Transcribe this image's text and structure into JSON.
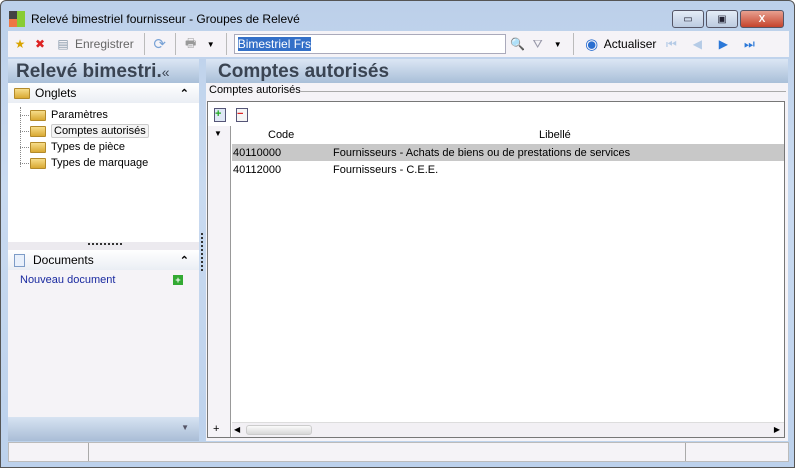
{
  "window": {
    "title": "Relevé bimestriel fournisseur -  Groupes de Relevé",
    "minimize": "▭",
    "maximize": "▣",
    "close": "X"
  },
  "toolbar": {
    "save_label": "Enregistrer",
    "search_value": "Bimestriel Frs",
    "refresh_label": "Actualiser"
  },
  "left_panel": {
    "title": "Relevé bimestri.",
    "collapse": "«",
    "onglets_header": "Onglets",
    "onglets_items": [
      {
        "label": "Paramètres"
      },
      {
        "label": "Comptes autorisés"
      },
      {
        "label": "Types de pièce"
      },
      {
        "label": "Types de marquage"
      }
    ],
    "documents_header": "Documents",
    "new_document_link": "Nouveau document",
    "chevron": "⌃"
  },
  "main": {
    "title": "Comptes autorisés",
    "group_label": "Comptes autorisés",
    "columns": {
      "code": "Code",
      "libelle": "Libellé"
    },
    "rows": [
      {
        "code": "40110000",
        "libelle": "Fournisseurs - Achats de biens ou de prestations de services"
      },
      {
        "code": "40112000",
        "libelle": "Fournisseurs - C.E.E."
      }
    ],
    "add_row": "+"
  }
}
